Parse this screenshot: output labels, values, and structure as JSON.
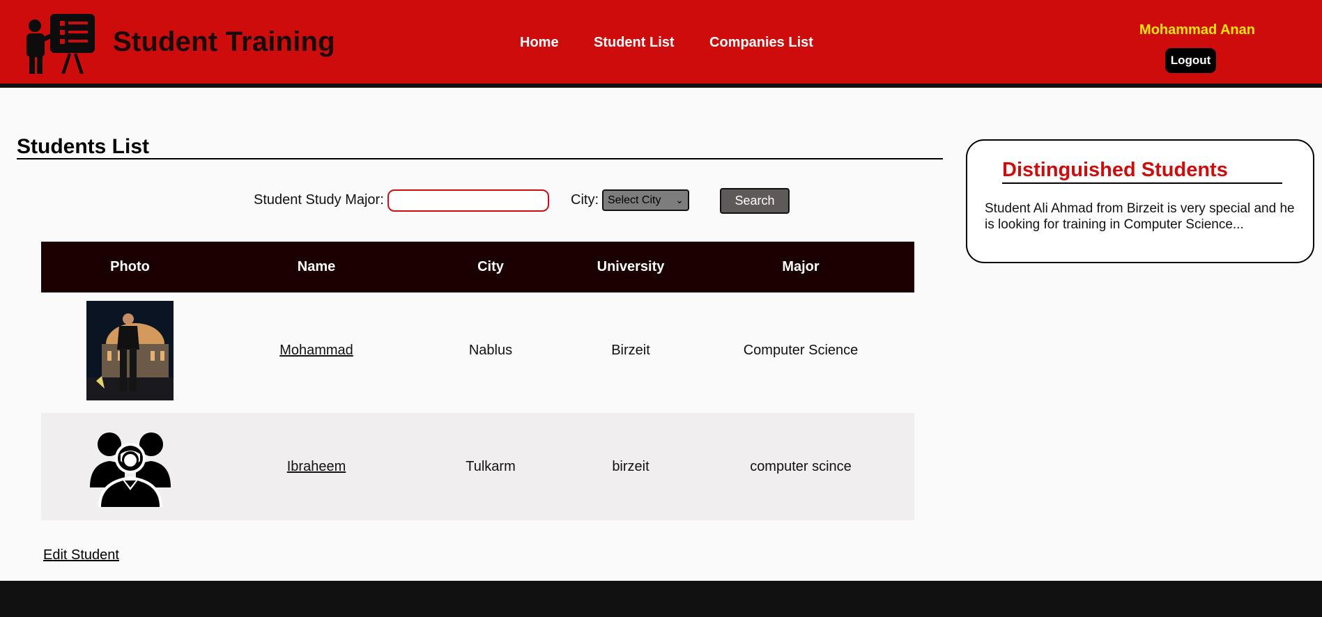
{
  "header": {
    "brand": "Student Training",
    "nav": [
      {
        "label": "Home"
      },
      {
        "label": "Student List"
      },
      {
        "label": "Companies List"
      }
    ],
    "user_name": "Mohammad Anan",
    "logout_label": "Logout"
  },
  "main": {
    "title": "Students List",
    "search": {
      "major_label": "Student Study Major:",
      "major_value": "",
      "city_label": "City:",
      "city_selected": "Select City",
      "search_label": "Search"
    },
    "table": {
      "headers": [
        "Photo",
        "Name",
        "City",
        "University",
        "Major"
      ],
      "rows": [
        {
          "name": "Mohammad",
          "city": "Nablus",
          "university": "Birzeit",
          "major": "Computer Science"
        },
        {
          "name": "Ibraheem",
          "city": "Tulkarm",
          "university": "birzeit",
          "major": "computer scince"
        }
      ]
    },
    "edit_link": "Edit Student"
  },
  "sidebar": {
    "title": "Distinguished Students",
    "text": "Student Ali Ahmad from Birzeit is very special and he is looking for training in Computer Science..."
  },
  "colors": {
    "header_bg": "#cf0c0c",
    "user_name": "#ffe600",
    "table_header_bg": "#1a0000",
    "accent_red": "#cf0c0c"
  }
}
